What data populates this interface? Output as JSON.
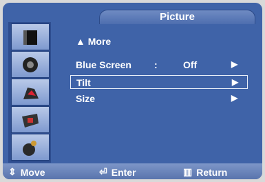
{
  "title": "Picture",
  "more_label": "▲ More",
  "menu": [
    {
      "label": "Blue Screen",
      "colon": ":",
      "value": "Off",
      "arrow": "▶"
    },
    {
      "label": "Tilt",
      "arrow": "▶"
    },
    {
      "label": "Size",
      "arrow": "▶"
    }
  ],
  "sidebar": {
    "icons": [
      "input-icon",
      "sound-icon",
      "channel-icon",
      "setup-icon",
      "function-icon"
    ]
  },
  "footer": {
    "move_label": "Move",
    "enter_label": "Enter",
    "return_label": "Return"
  },
  "colors": {
    "panel": "#3f63a8",
    "sidebar": "#2e4d8f",
    "text": "#ffffff"
  }
}
